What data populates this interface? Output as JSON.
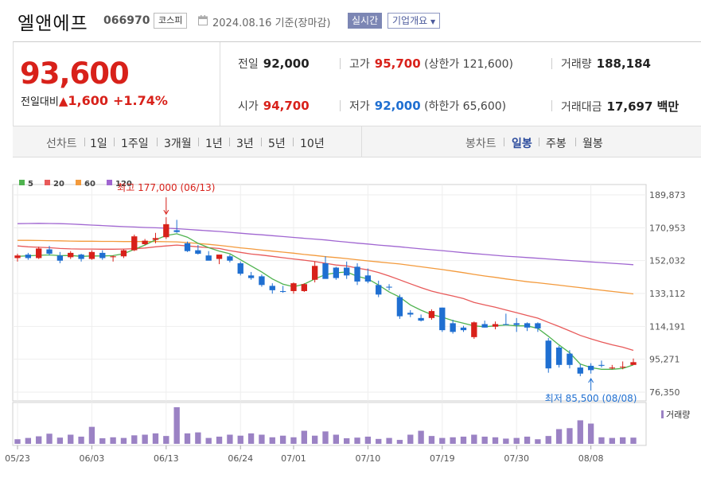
{
  "stock": {
    "name": "엘앤에프",
    "code": "066970",
    "market": "코스피",
    "date": "2024.08.16 기준(장마감)",
    "realtime_label": "실시간",
    "overview_label": "기업개요",
    "price": "93,600",
    "change_label": "전일대비",
    "change_symbol": "▲",
    "change_amount": "1,600",
    "change_pct": "+1.74%",
    "prev_label": "전일",
    "prev": "92,000",
    "open_label": "시가",
    "open": "94,700",
    "high_label": "고가",
    "high": "95,700",
    "upper_limit": "(상한가 121,600)",
    "low_label": "저가",
    "low": "92,000",
    "lower_limit": "(하한가 65,600)",
    "volume_label": "거래량",
    "volume": "188,184",
    "amount_label": "거래대금",
    "amount": "17,697 백만"
  },
  "toolbar": {
    "line_chart": "선차트",
    "periods": [
      "1일",
      "1주일",
      "3개월",
      "1년",
      "3년",
      "5년",
      "10년"
    ],
    "candle_chart": "봉차트",
    "candle_periods": [
      "일봉",
      "주봉",
      "월봉"
    ],
    "selected_candle": "일봉"
  },
  "colors": {
    "up": "#d8211a",
    "down": "#1f6fd1",
    "ma5": "#4fb34f",
    "ma20": "#e85a5a",
    "ma60": "#f39a3c",
    "ma120": "#a066d1",
    "volume": "#9b82c4"
  },
  "chart_data": {
    "type": "candlestick",
    "legend": [
      {
        "name": "5",
        "color": "#4fb34f"
      },
      {
        "name": "20",
        "color": "#e85a5a"
      },
      {
        "name": "60",
        "color": "#f39a3c"
      },
      {
        "name": "120",
        "color": "#a066d1"
      }
    ],
    "y_ticks": [
      "189,873",
      "170,953",
      "152,032",
      "133,112",
      "114,191",
      "95,271",
      "76,350"
    ],
    "ylim": [
      76350,
      189873
    ],
    "x_ticks": [
      "05/23",
      "06/03",
      "06/13",
      "06/24",
      "07/01",
      "07/10",
      "07/19",
      "07/30",
      "08/08"
    ],
    "x_tick_index": [
      0,
      7,
      14,
      21,
      26,
      33,
      40,
      47,
      54
    ],
    "volume_label": "거래량",
    "high_annotation": "최고 177,000 (06/13)",
    "high_annotation_index": 14,
    "high_value": 177000,
    "low_annotation": "최저 85,500 (08/08)",
    "low_annotation_index": 54,
    "low_value": 85500,
    "ohlc": [
      [
        153500,
        156000,
        151500,
        155000
      ],
      [
        155500,
        156500,
        152500,
        153500
      ],
      [
        153500,
        160000,
        153000,
        159000
      ],
      [
        158500,
        160500,
        155000,
        156000
      ],
      [
        155000,
        157000,
        150500,
        152000
      ],
      [
        154000,
        157500,
        153000,
        156500
      ],
      [
        155500,
        156000,
        151500,
        153000
      ],
      [
        153000,
        158000,
        152500,
        157000
      ],
      [
        156500,
        158000,
        152500,
        153500
      ],
      [
        154000,
        155000,
        151500,
        154500
      ],
      [
        154500,
        158500,
        153500,
        158000
      ],
      [
        158000,
        167000,
        157500,
        166000
      ],
      [
        161500,
        164500,
        161000,
        163500
      ],
      [
        164000,
        168000,
        162000,
        165000
      ],
      [
        165500,
        177000,
        164500,
        173000
      ],
      [
        169500,
        175500,
        168000,
        168500
      ],
      [
        162000,
        163000,
        157000,
        157500
      ],
      [
        158000,
        161000,
        155500,
        156000
      ],
      [
        155000,
        157500,
        152500,
        152000
      ],
      [
        153000,
        155000,
        150000,
        155500
      ],
      [
        154500,
        155500,
        151000,
        152000
      ],
      [
        150500,
        151500,
        143500,
        144500
      ],
      [
        143500,
        145500,
        141000,
        142000
      ],
      [
        143000,
        144000,
        137000,
        138000
      ],
      [
        137500,
        139000,
        133000,
        135000
      ],
      [
        134500,
        137500,
        133500,
        134000
      ],
      [
        134500,
        139500,
        133000,
        139000
      ],
      [
        134500,
        139000,
        134000,
        138500
      ],
      [
        141000,
        151500,
        139500,
        149000
      ],
      [
        150500,
        154500,
        142000,
        141500
      ],
      [
        148000,
        148500,
        141000,
        142000
      ],
      [
        148000,
        151500,
        141500,
        143500
      ],
      [
        148500,
        150500,
        138000,
        140000
      ],
      [
        143500,
        147500,
        139000,
        140000
      ],
      [
        138000,
        140500,
        131000,
        132500
      ],
      [
        137000,
        138500,
        135000,
        136500
      ],
      [
        131000,
        132500,
        118500,
        120000
      ],
      [
        122000,
        123500,
        119500,
        121000
      ],
      [
        119000,
        121000,
        117000,
        117500
      ],
      [
        119000,
        124000,
        118000,
        123000
      ],
      [
        125000,
        125000,
        111000,
        112000
      ],
      [
        116000,
        118000,
        110000,
        111000
      ],
      [
        113500,
        114500,
        111000,
        112000
      ],
      [
        108000,
        117000,
        107000,
        116500
      ],
      [
        115500,
        117500,
        113500,
        113500
      ],
      [
        114000,
        117000,
        112500,
        115500
      ],
      [
        115500,
        121500,
        115000,
        115000
      ],
      [
        116000,
        119000,
        111000,
        115000
      ],
      [
        116000,
        116500,
        111500,
        113500
      ],
      [
        116000,
        116500,
        111000,
        113000
      ],
      [
        106000,
        107500,
        87500,
        90000
      ],
      [
        102000,
        103000,
        90500,
        92000
      ],
      [
        98500,
        100500,
        90000,
        92000
      ],
      [
        90500,
        92500,
        85500,
        87000
      ],
      [
        91500,
        93000,
        87000,
        89000
      ],
      [
        92000,
        94500,
        90500,
        91500
      ],
      [
        90000,
        92000,
        89500,
        90500
      ],
      [
        91000,
        94000,
        89500,
        91000
      ],
      [
        92000,
        95700,
        92000,
        93600
      ]
    ],
    "volume": [
      14,
      18,
      23,
      31,
      19,
      28,
      22,
      52,
      17,
      20,
      18,
      26,
      28,
      32,
      24,
      112,
      32,
      35,
      18,
      22,
      28,
      25,
      32,
      28,
      20,
      25,
      20,
      40,
      25,
      38,
      28,
      17,
      19,
      22,
      15,
      18,
      12,
      28,
      40,
      24,
      18,
      20,
      22,
      28,
      22,
      20,
      16,
      18,
      22,
      14,
      24,
      45,
      48,
      72,
      62,
      20,
      18,
      20,
      19
    ],
    "ma5": [
      154500,
      154800,
      155100,
      155300,
      154900,
      155000,
      154500,
      154700,
      154700,
      154900,
      156000,
      158500,
      161000,
      164000,
      166500,
      167500,
      165500,
      162000,
      159500,
      157500,
      156000,
      152500,
      149000,
      145500,
      141500,
      138500,
      137000,
      138500,
      141500,
      144000,
      145000,
      145500,
      143000,
      141500,
      138000,
      134000,
      131000,
      126500,
      123500,
      121000,
      119500,
      117500,
      116000,
      114500,
      114000,
      114500,
      115000,
      114500,
      114500,
      113000,
      108500,
      103500,
      99000,
      92500,
      90500,
      89500,
      89500,
      90000,
      92000
    ],
    "ma20": [
      160500,
      160000,
      159700,
      159500,
      159000,
      158800,
      158700,
      158700,
      158600,
      158600,
      158700,
      158900,
      159300,
      160000,
      160500,
      161000,
      160500,
      160000,
      159500,
      159000,
      157800,
      156800,
      155800,
      155200,
      154500,
      153700,
      153000,
      152300,
      151500,
      150500,
      149500,
      149000,
      147700,
      146700,
      145200,
      143200,
      141000,
      138700,
      136500,
      134500,
      133000,
      131700,
      130200,
      128000,
      126500,
      125200,
      123600,
      122100,
      120500,
      118900,
      116500,
      114100,
      111600,
      109000,
      107000,
      105200,
      103600,
      102200,
      100400
    ],
    "ma60": [
      163700,
      163700,
      163600,
      163500,
      163400,
      163300,
      163200,
      163200,
      163100,
      163100,
      163000,
      163000,
      163000,
      163000,
      162900,
      162800,
      162400,
      161900,
      161400,
      160800,
      160100,
      159400,
      158800,
      158100,
      157500,
      156900,
      156300,
      155600,
      155000,
      154300,
      153800,
      153200,
      152500,
      151900,
      151300,
      150700,
      150100,
      149300,
      148500,
      147700,
      146900,
      146000,
      145100,
      144100,
      143200,
      142400,
      141500,
      140700,
      139900,
      139300,
      138600,
      137900,
      137200,
      136500,
      135700,
      135000,
      134300,
      133600,
      132900
    ],
    "ma120": [
      173300,
      173400,
      173500,
      173400,
      173300,
      173100,
      172800,
      172500,
      172200,
      171900,
      171600,
      171400,
      171100,
      170900,
      170700,
      170400,
      170000,
      169600,
      169200,
      168800,
      168300,
      167800,
      167300,
      166900,
      166400,
      165900,
      165400,
      164900,
      164400,
      163900,
      163300,
      162700,
      162100,
      161600,
      161000,
      160500,
      160000,
      159400,
      158800,
      158300,
      157800,
      157200,
      156600,
      156100,
      155600,
      155100,
      154600,
      154200,
      153800,
      153400,
      153000,
      152500,
      152100,
      151700,
      151300,
      150900,
      150500,
      150100,
      149700
    ]
  }
}
